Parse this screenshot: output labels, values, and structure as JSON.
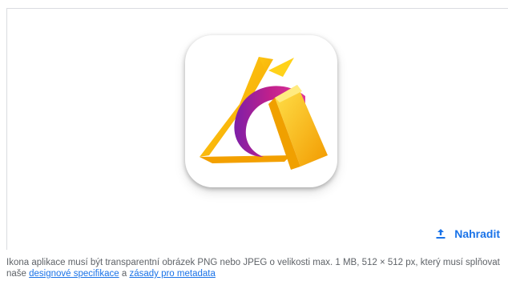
{
  "upload": {
    "replace_label": "Nahradit",
    "icon_semantic": "upload-icon"
  },
  "app_icon": {
    "semantic": "app-logo-image",
    "colors": {
      "yellow": "#f7c400",
      "orange": "#f59a00",
      "magenta": "#c0208c",
      "purple": "#8a1fa3"
    }
  },
  "help": {
    "text_before": "Ikona aplikace musí být transparentní obrázek PNG nebo JPEG o velikosti max. 1 MB, 512 × 512 px, který musí splňovat naše ",
    "link_design": "designové specifikace",
    "text_middle": " a ",
    "link_metadata": "zásady pro metadata"
  },
  "colors": {
    "accent": "#1a73e8",
    "border": "#dadce0",
    "muted_text": "#5f6368"
  }
}
